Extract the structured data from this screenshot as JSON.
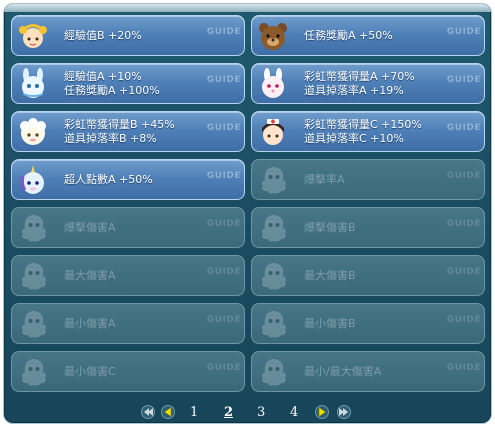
{
  "slots": [
    {
      "lines": [
        "經驗值B +20%"
      ],
      "state": "active",
      "portrait": "yellow-haired-girl-portrait",
      "guide": "GUIDE"
    },
    {
      "lines": [
        "任務獎勵A +50%"
      ],
      "state": "active",
      "portrait": "brown-bear-portrait",
      "guide": "GUIDE"
    },
    {
      "lines": [
        "經驗值A +10%",
        "任務獎勵A +100%"
      ],
      "state": "active",
      "portrait": "blue-bunny-portrait",
      "guide": "GUIDE"
    },
    {
      "lines": [
        "彩虹幣獲得量A +70%",
        "道具掉落率A +19%"
      ],
      "state": "active",
      "portrait": "pink-rabbit-portrait",
      "guide": "GUIDE"
    },
    {
      "lines": [
        "彩虹幣獲得量B +45%",
        "道具掉落率B +8%"
      ],
      "state": "active",
      "portrait": "white-sheep-portrait",
      "guide": "GUIDE"
    },
    {
      "lines": [
        "彩虹幣獲得量C +150%",
        "道具掉落率C +10%"
      ],
      "state": "active",
      "portrait": "nurse-girl-portrait",
      "guide": "GUIDE"
    },
    {
      "lines": [
        "超人點數A +50%"
      ],
      "state": "active",
      "portrait": "unicorn-portrait",
      "guide": "GUIDE"
    },
    {
      "lines": [
        "爆擊率A"
      ],
      "state": "locked",
      "portrait": "locked-ghost-icon",
      "guide": "GUIDE"
    },
    {
      "lines": [
        "爆擊傷害A"
      ],
      "state": "locked",
      "portrait": "locked-ghost-icon",
      "guide": "GUIDE"
    },
    {
      "lines": [
        "爆擊傷害B"
      ],
      "state": "locked",
      "portrait": "locked-ghost-icon",
      "guide": "GUIDE"
    },
    {
      "lines": [
        "最大傷害A"
      ],
      "state": "locked",
      "portrait": "locked-ghost-icon",
      "guide": "GUIDE"
    },
    {
      "lines": [
        "最大傷害B"
      ],
      "state": "locked",
      "portrait": "locked-ghost-icon",
      "guide": "GUIDE"
    },
    {
      "lines": [
        "最小傷害A"
      ],
      "state": "locked",
      "portrait": "locked-ghost-icon",
      "guide": "GUIDE"
    },
    {
      "lines": [
        "最小傷害B"
      ],
      "state": "locked",
      "portrait": "locked-ghost-icon",
      "guide": "GUIDE"
    },
    {
      "lines": [
        "最小傷害C"
      ],
      "state": "locked",
      "portrait": "locked-ghost-icon",
      "guide": "GUIDE"
    },
    {
      "lines": [
        "最小/最大傷害A"
      ],
      "state": "locked",
      "portrait": "locked-ghost-icon",
      "guide": "GUIDE"
    }
  ],
  "pagination": {
    "pages": [
      "1",
      "2",
      "3",
      "4"
    ],
    "current": "2",
    "icons": [
      "first-page-icon",
      "prev-page-icon",
      "next-page-icon",
      "last-page-icon"
    ]
  },
  "colors": {
    "panel": "#1b4d63",
    "active_slot": "#4f80b7",
    "locked_slot": "#406f81",
    "arrow": "#f2e200"
  }
}
